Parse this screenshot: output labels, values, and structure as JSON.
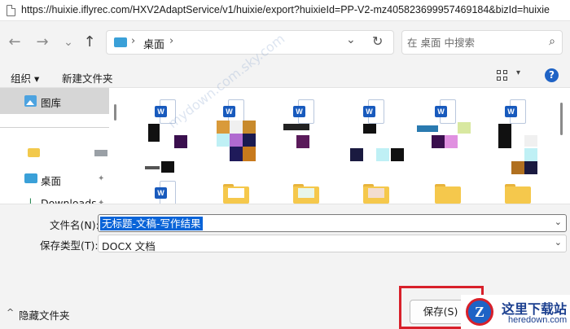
{
  "browser": {
    "url": "https://huixie.iflyrec.com/HXV2AdaptService/v1/huixie/export?huixieId=PP-V2-mz405823699957469184&bizId=huixie"
  },
  "dialog": {
    "nav": {
      "back_glyph": "←",
      "forward_glyph": "→",
      "recent_glyph": "⌄",
      "up_glyph": "↑"
    },
    "address": {
      "sep1": "›",
      "location": "桌面",
      "sep2": "›",
      "dropdown_glyph": "⌄",
      "refresh_glyph": "↻"
    },
    "search": {
      "placeholder": "在 桌面 中搜索",
      "icon_glyph": "⌕"
    },
    "toolbar": {
      "organize": "组织 ▾",
      "new_folder": "新建文件夹",
      "view_caret": "▾",
      "help_glyph": "?"
    },
    "sidebar": {
      "items": [
        {
          "label": "图库",
          "icon": "gallery-icon"
        },
        {
          "label": "桌面",
          "icon": "desktop-icon",
          "pinned": true
        },
        {
          "label": "Downloads",
          "icon": "download-icon",
          "pinned": true
        }
      ],
      "pin_glyph": "✦",
      "download_glyph": "↓"
    },
    "files": {
      "word_badge": "W"
    },
    "form": {
      "filename_label": "文件名(N):",
      "filename_value": "无标题-文稿-写作结果",
      "filetype_label": "保存类型(T):",
      "filetype_value": "DOCX 文档",
      "caret_glyph": "⌄"
    },
    "footer": {
      "hide_folders_caret": "^",
      "hide_folders": "隐藏文件夹",
      "save": "保存(S)"
    }
  },
  "watermark": {
    "site_name": "这里下载站",
    "site_domain": "heredown.com",
    "logo_letter": "Z",
    "faint_text": "mydown.com.sky.com"
  },
  "colors": {
    "accent": "#0a64d8",
    "word_blue": "#185abd",
    "highlight_border": "#d8202a",
    "folder_yellow": "#f5c84c"
  }
}
